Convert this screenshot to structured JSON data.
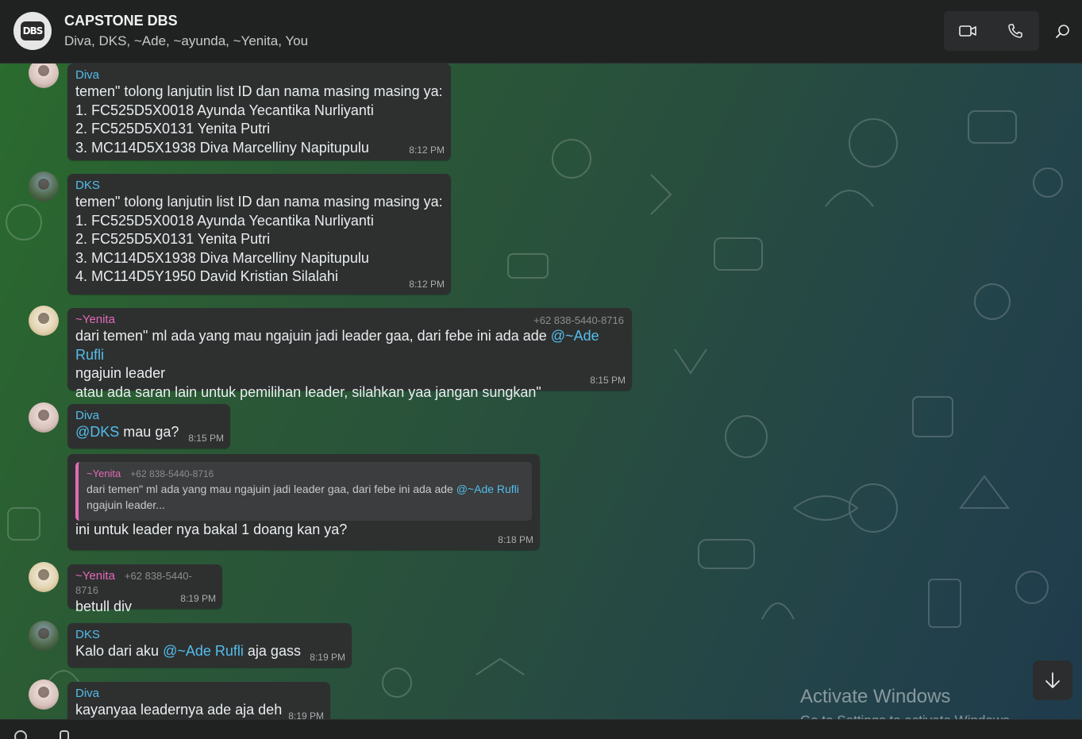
{
  "header": {
    "avatar_text": "DBS",
    "title": "CAPSTONE DBS",
    "members": "Diva, DKS, ~Ade, ~ayunda, ~Yenita, You"
  },
  "messages": [
    {
      "sender": "Diva",
      "text": "temen\" tolong lanjutin list ID dan nama masing masing ya:\n1. FC525D5X0018 Ayunda Yecantika Nurliyanti\n2. FC525D5X0131 Yenita Putri\n3. MC114D5X1938 Diva Marcelliny Napitupulu",
      "time": "8:12 PM"
    },
    {
      "sender": "DKS",
      "text": "temen\" tolong lanjutin list ID dan nama masing masing ya:\n1. FC525D5X0018 Ayunda Yecantika Nurliyanti\n2. FC525D5X0131 Yenita Putri\n3. MC114D5X1938 Diva Marcelliny Napitupulu\n4. MC114D5Y1950 David Kristian Silalahi",
      "time": "8:12 PM"
    },
    {
      "sender": "~Yenita",
      "phone": "+62 838-5440-8716",
      "text_before": "dari temen\" ml ada yang mau ngajuin jadi leader gaa, dari febe ini ada ade ",
      "mention": "@~Ade Rufli",
      "text_after": "\nngajuin leader\natau ada saran lain untuk pemilihan leader, silahkan yaa jangan sungkan\"",
      "time": "8:15 PM"
    },
    {
      "sender": "Diva",
      "mention": "@DKS",
      "text_after": " mau ga?",
      "time": "8:15 PM"
    },
    {
      "quote_sender": "~Yenita",
      "quote_phone": "+62 838-5440-8716",
      "quote_text_before": "dari temen\" ml ada yang mau ngajuin jadi leader gaa, dari febe ini ada ade ",
      "quote_mention": "@~Ade Rufli",
      "quote_text_after": " ngajuin leader...",
      "text": "ini untuk leader nya bakal 1 doang kan ya?",
      "time": "8:18 PM"
    },
    {
      "sender": "~Yenita",
      "phone": "+62 838-5440-8716",
      "text": "betull div",
      "time": "8:19 PM"
    },
    {
      "sender": "DKS",
      "text_before": "Kalo dari aku ",
      "mention": "@~Ade Rufli",
      "text_after": " aja gass",
      "time": "8:19 PM"
    },
    {
      "sender": "Diva",
      "text": "kayanyaa leadernya ade aja deh",
      "time": "8:19 PM"
    }
  ],
  "watermark": {
    "line1": "Activate Windows",
    "line2": "Go to Settings to activate Windows."
  },
  "icons": [
    "video-call-icon",
    "voice-call-icon",
    "search-icon",
    "arrow-down-icon"
  ],
  "colors": {
    "header_bg": "#202222",
    "bubble_bg": "#2e3030",
    "mention": "#53bdeb",
    "yenita_name": "#e26ab6",
    "time": "#a9acad"
  }
}
